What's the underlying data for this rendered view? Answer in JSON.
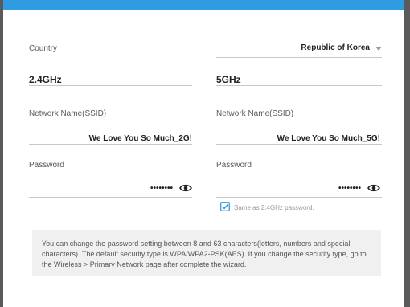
{
  "country": {
    "label": "Country",
    "value": "Republic of Korea"
  },
  "band_24": {
    "heading": "2.4GHz",
    "ssid_label": "Network Name(SSID)",
    "ssid_value": "We Love You So Much_2G!",
    "password_label": "Password",
    "password_mask": "••••••••",
    "eye_icon": "eye-icon"
  },
  "band_5": {
    "heading": "5GHz",
    "ssid_label": "Network Name(SSID)",
    "ssid_value": "We Love You So Much_5G!",
    "password_label": "Password",
    "password_mask": "••••••••",
    "eye_icon": "eye-icon",
    "same_password_label": "Same as 2.4GHz password.",
    "same_password_checked": true
  },
  "notice": {
    "text": "You can change the password setting between 8 and 63 characters(letters, numbers and special characters). The default security type is WPA/WPA2-PSK(AES). If you change the security type, go to the Wireless > Primary Network page after complete the wizard."
  },
  "colors": {
    "accent": "#2f9be0",
    "checkbox": "#3a9ad9"
  }
}
